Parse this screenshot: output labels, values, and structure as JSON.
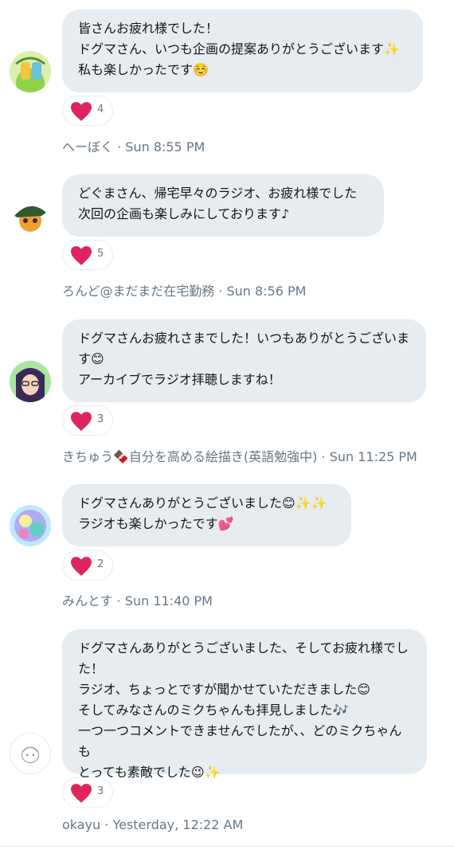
{
  "comments": [
    {
      "lines": [
        "皆さんお疲れ様でした！",
        "ドグマさん、いつも企画の提案ありがとうございます✨",
        "私も楽しかったです☺️"
      ],
      "likes": "4",
      "author": "へーぼく",
      "time": "Sun 8:55 PM",
      "avatar_colors": [
        "#d8f0b0",
        "#8fd34a",
        "#f5c542"
      ]
    },
    {
      "lines": [
        "どぐまさん、帰宅早々のラジオ、お疲れ様でした",
        "次回の企画も楽しみにしております♪"
      ],
      "likes": "5",
      "author": "ろんど@まだまだ在宅勤務",
      "time": "Sun 8:56 PM",
      "avatar_colors": [
        "#ffffff",
        "#2e5a2e",
        "#f0a030"
      ]
    },
    {
      "lines": [
        "ドグマさんお疲れさまでした！いつもありがとうございま",
        "す😊",
        "アーカイブでラジオ拝聴しますね！"
      ],
      "likes": "3",
      "author": "きちゅう🍫自分を高める絵描き(英語勉強中)",
      "time": "Sun 11:25 PM",
      "avatar_colors": [
        "#a8e6a0",
        "#3a2a5a",
        "#f4d6c0"
      ]
    },
    {
      "lines": [
        "ドグマさんありがとうございました😊✨✨",
        "ラジオも楽しかったです💕"
      ],
      "likes": "2",
      "author": "みんとす",
      "time": "Sun 11:40 PM",
      "avatar_colors": [
        "#c0e8ff",
        "#a070e0",
        "#f0f0a0"
      ]
    },
    {
      "lines": [
        "ドグマさんありがとうございました、そしてお疲れ様でし",
        "た！",
        "ラジオ、ちょっとですが聞かせていただきました😊",
        "そしてみなさんのミクちゃんも拝見しました🎶",
        "一つ一つコメントできませんでしたが、、どのミクちゃんも",
        "とっても素敵でした😉✨"
      ],
      "likes": "3",
      "author": "okayu",
      "time": "Yesterday, 12:22 AM",
      "avatar_colors": [
        "#ffffff",
        "#d0d0d0",
        "#a0a0a0"
      ]
    }
  ],
  "separator": " · ",
  "colors": {
    "bubble_bg": "#e6ecf0",
    "heart": "#e0245e",
    "meta_text": "#657786",
    "body_text": "#14171a"
  },
  "icons": {
    "like": "heart-icon"
  }
}
